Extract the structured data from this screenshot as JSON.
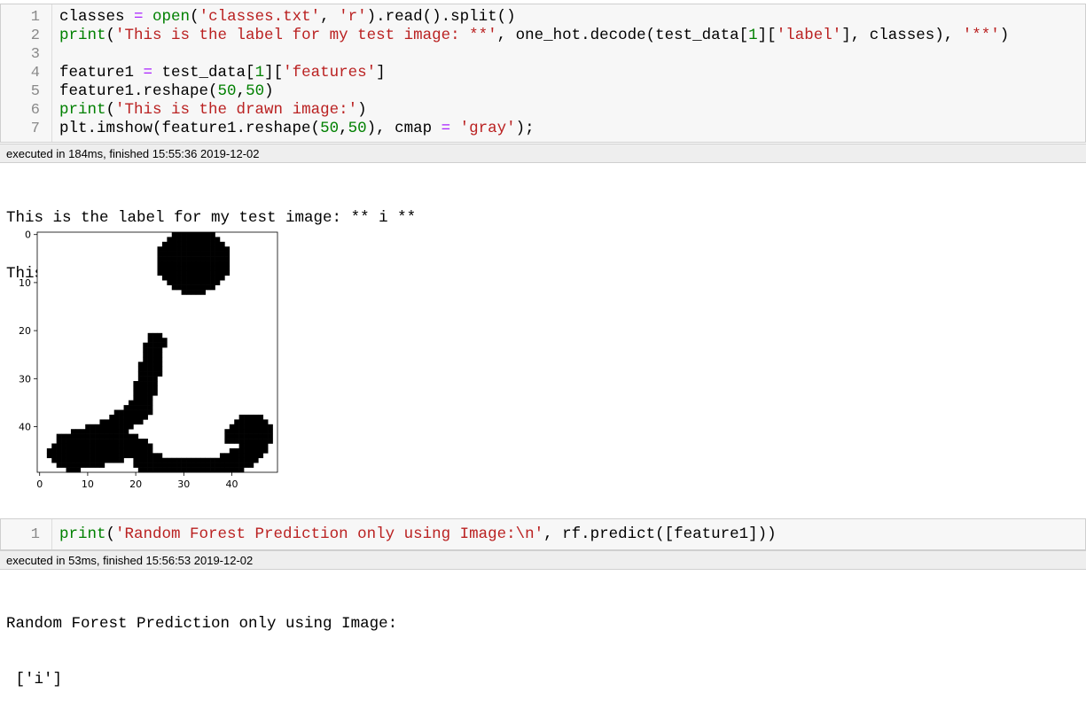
{
  "cell1": {
    "line_numbers": [
      "1",
      "2",
      "3",
      "4",
      "5",
      "6",
      "7"
    ],
    "lines": [
      [
        [
          "v",
          "classes "
        ],
        [
          "op",
          "="
        ],
        [
          "v",
          " "
        ],
        [
          "kw",
          "open"
        ],
        [
          "v",
          "("
        ],
        [
          "str",
          "'classes.txt'"
        ],
        [
          "v",
          ", "
        ],
        [
          "str",
          "'r'"
        ],
        [
          "v",
          ").read().split()"
        ]
      ],
      [
        [
          "kw",
          "print"
        ],
        [
          "v",
          "("
        ],
        [
          "str",
          "'This is the label for my test image: **'"
        ],
        [
          "v",
          ", one_hot.decode(test_data["
        ],
        [
          "num",
          "1"
        ],
        [
          "v",
          "]["
        ],
        [
          "str",
          "'label'"
        ],
        [
          "v",
          "], classes), "
        ],
        [
          "str",
          "'**'"
        ],
        [
          "v",
          ")"
        ]
      ],
      [],
      [
        [
          "v",
          "feature1 "
        ],
        [
          "op",
          "="
        ],
        [
          "v",
          " test_data["
        ],
        [
          "num",
          "1"
        ],
        [
          "v",
          "]["
        ],
        [
          "str",
          "'features'"
        ],
        [
          "v",
          "]"
        ]
      ],
      [
        [
          "v",
          "feature1.reshape("
        ],
        [
          "num",
          "50"
        ],
        [
          "v",
          ","
        ],
        [
          "num",
          "50"
        ],
        [
          "v",
          ")"
        ]
      ],
      [
        [
          "kw",
          "print"
        ],
        [
          "v",
          "("
        ],
        [
          "str",
          "'This is the drawn image:'"
        ],
        [
          "v",
          ")"
        ]
      ],
      [
        [
          "v",
          "plt.imshow(feature1.reshape("
        ],
        [
          "num",
          "50"
        ],
        [
          "v",
          ","
        ],
        [
          "num",
          "50"
        ],
        [
          "v",
          "), cmap "
        ],
        [
          "op",
          "="
        ],
        [
          "v",
          " "
        ],
        [
          "str",
          "'gray'"
        ],
        [
          "v",
          ");"
        ]
      ]
    ],
    "exec_info": "executed in 184ms, finished 15:55:36 2019-12-02"
  },
  "output1": {
    "line1": "This is the label for my test image: ** i **",
    "line2": "This is the drawn image:"
  },
  "chart_data": {
    "type": "heatmap",
    "title": "",
    "xlabel": "",
    "ylabel": "",
    "cmap": "gray",
    "shape": [
      50,
      50
    ],
    "xlim": [
      0,
      49
    ],
    "ylim": [
      49,
      0
    ],
    "xticks": [
      "0",
      "10",
      "20",
      "30",
      "40"
    ],
    "yticks": [
      "0",
      "10",
      "20",
      "30",
      "40"
    ],
    "glyph": "i",
    "colors": {
      "ink": "#000000",
      "background": "#ffffff"
    }
  },
  "cell2": {
    "line_numbers": [
      "1"
    ],
    "lines": [
      [
        [
          "kw",
          "print"
        ],
        [
          "v",
          "("
        ],
        [
          "str",
          "'Random Forest Prediction only using Image:\\n'"
        ],
        [
          "v",
          ", rf.predict([feature1]))"
        ]
      ]
    ],
    "exec_info": "executed in 53ms, finished 15:56:53 2019-12-02"
  },
  "output2": {
    "line1": "Random Forest Prediction only using Image:",
    "line2": " ['i']"
  }
}
